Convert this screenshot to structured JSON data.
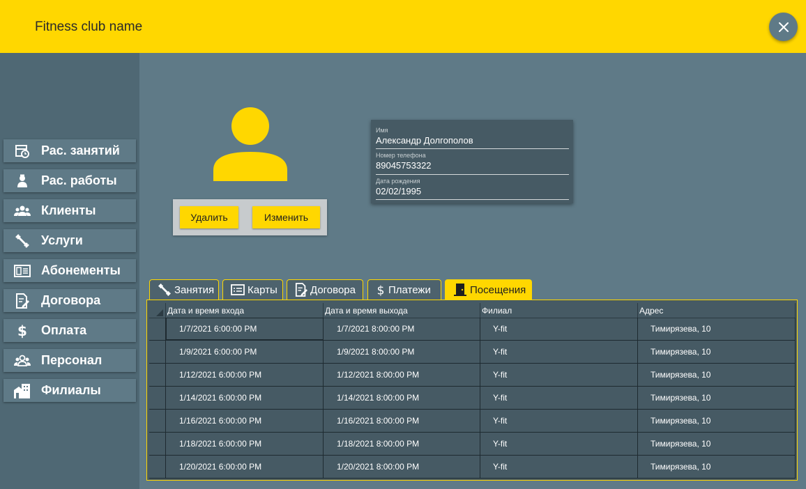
{
  "app": {
    "title": "Fitness club name"
  },
  "sidebar": {
    "items": [
      {
        "label": "Рас. занятий",
        "icon": "schedule-icon"
      },
      {
        "label": "Рас. работы",
        "icon": "worker-icon"
      },
      {
        "label": "Клиенты",
        "icon": "clients-icon"
      },
      {
        "label": "Услуги",
        "icon": "dumbbell-icon"
      },
      {
        "label": "Абонементы",
        "icon": "membership-card-icon"
      },
      {
        "label": "Договора",
        "icon": "contract-icon"
      },
      {
        "label": "Оплата",
        "icon": "dollar-icon"
      },
      {
        "label": "Персонал",
        "icon": "staff-icon"
      },
      {
        "label": "Филиалы",
        "icon": "building-icon"
      }
    ]
  },
  "actions": {
    "delete_label": "Удалить",
    "edit_label": "Изменить"
  },
  "client": {
    "name_label": "Имя",
    "name": "Александр Долгополов",
    "phone_label": "Номер телефона",
    "phone": "89045753322",
    "birth_label": "Дата рождения",
    "birth": "02/02/1995"
  },
  "tabs": [
    {
      "label": "Занятия",
      "icon": "dumbbell-icon"
    },
    {
      "label": "Карты",
      "icon": "card-icon"
    },
    {
      "label": "Договора",
      "icon": "contract-icon"
    },
    {
      "label": "Платежи",
      "icon": "dollar-icon"
    },
    {
      "label": "Посещения",
      "icon": "door-icon",
      "active": true
    }
  ],
  "visits": {
    "columns": [
      "Дата и время входа",
      "Дата и время выхода",
      "Филиал",
      "Адрес"
    ],
    "rows": [
      [
        "1/7/2021 6:00:00 PM",
        "1/7/2021 8:00:00 PM",
        "Y-fit",
        "Тимирязева, 10"
      ],
      [
        "1/9/2021 6:00:00 PM",
        "1/9/2021 8:00:00 PM",
        "Y-fit",
        "Тимирязева, 10"
      ],
      [
        "1/12/2021 6:00:00 PM",
        "1/12/2021 8:00:00 PM",
        "Y-fit",
        "Тимирязева, 10"
      ],
      [
        "1/14/2021 6:00:00 PM",
        "1/14/2021 8:00:00 PM",
        "Y-fit",
        "Тимирязева, 10"
      ],
      [
        "1/16/2021 6:00:00 PM",
        "1/16/2021 8:00:00 PM",
        "Y-fit",
        "Тимирязева, 10"
      ],
      [
        "1/18/2021 6:00:00 PM",
        "1/18/2021 8:00:00 PM",
        "Y-fit",
        "Тимирязева, 10"
      ],
      [
        "1/20/2021 6:00:00 PM",
        "1/20/2021 8:00:00 PM",
        "Y-fit",
        "Тимирязева, 10"
      ]
    ]
  },
  "colors": {
    "accent": "#ffd700",
    "background": "#5f7a87",
    "sidebar": "#4f6874",
    "panel": "#465a64"
  }
}
